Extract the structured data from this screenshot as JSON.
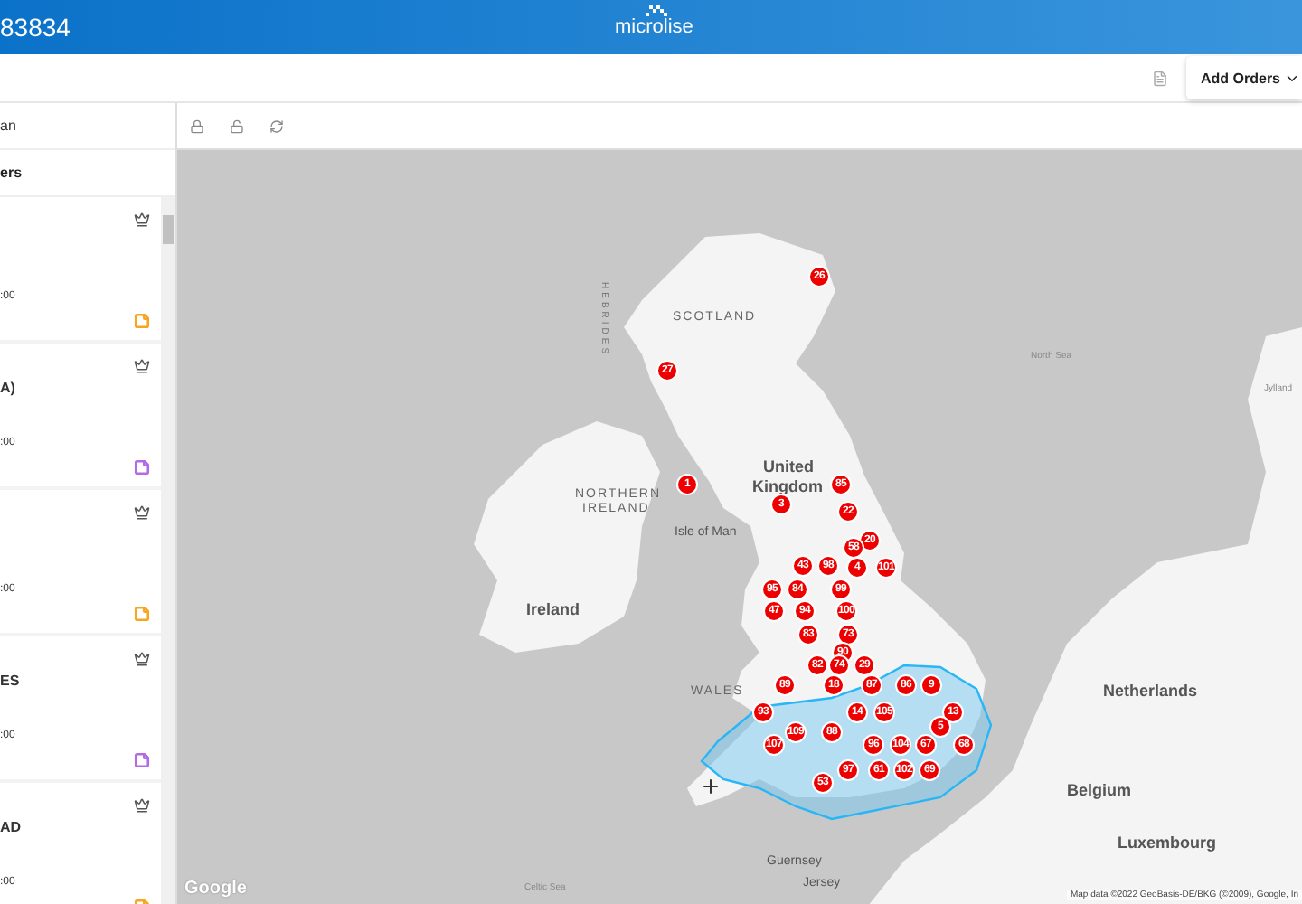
{
  "header": {
    "title": "83834",
    "logo": "microlise"
  },
  "toolbar": {
    "button": "Add Orders"
  },
  "sidebar": {
    "heading": "an",
    "subheading": "ers",
    "orders": [
      {
        "time": ":00",
        "color": "#f5a623"
      },
      {
        "title": "A)",
        "time": ":00",
        "color": "#b36ae2"
      },
      {
        "time": ":00",
        "color": "#f5a623"
      },
      {
        "title": "ES",
        "time": ":00",
        "color": "#b36ae2"
      },
      {
        "title": "AD",
        "time": ":00",
        "color": "#f5a623"
      }
    ]
  },
  "map": {
    "labels": [
      {
        "text": "SCOTLAND",
        "kind": "region"
      },
      {
        "text": "HEBRIDES",
        "kind": "vertical"
      },
      {
        "text": "NORTHERN",
        "kind": "region"
      },
      {
        "text": "IRELAND",
        "kind": "region"
      },
      {
        "text": "United",
        "kind": "country"
      },
      {
        "text": "Kingdom",
        "kind": "country"
      },
      {
        "text": "Isle of Man",
        "kind": "place"
      },
      {
        "text": "Ireland",
        "kind": "country"
      },
      {
        "text": "WALES",
        "kind": "region"
      },
      {
        "text": "North Sea",
        "kind": "sea"
      },
      {
        "text": "Jylland",
        "kind": "sea"
      },
      {
        "text": "Netherlands",
        "kind": "country"
      },
      {
        "text": "Belgium",
        "kind": "country"
      },
      {
        "text": "Luxembourg",
        "kind": "country"
      },
      {
        "text": "Guernsey",
        "kind": "place"
      },
      {
        "text": "Jersey",
        "kind": "place"
      },
      {
        "text": "Celtic Sea",
        "kind": "sea"
      }
    ],
    "markers": [
      "26",
      "27",
      "1",
      "85",
      "3",
      "22",
      "20",
      "58",
      "43",
      "98",
      "4",
      "101",
      "95",
      "84",
      "99",
      "47",
      "94",
      "100",
      "83",
      "73",
      "90",
      "82",
      "74",
      "29",
      "89",
      "18",
      "87",
      "86",
      "9",
      "93",
      "14",
      "105",
      "13",
      "5",
      "109",
      "88",
      "107",
      "96",
      "104",
      "67",
      "68",
      "97",
      "61",
      "102",
      "69",
      "53"
    ],
    "logo": "Google",
    "attribution": "Map data ©2022 GeoBasis-DE/BKG (©2009), Google, In"
  }
}
